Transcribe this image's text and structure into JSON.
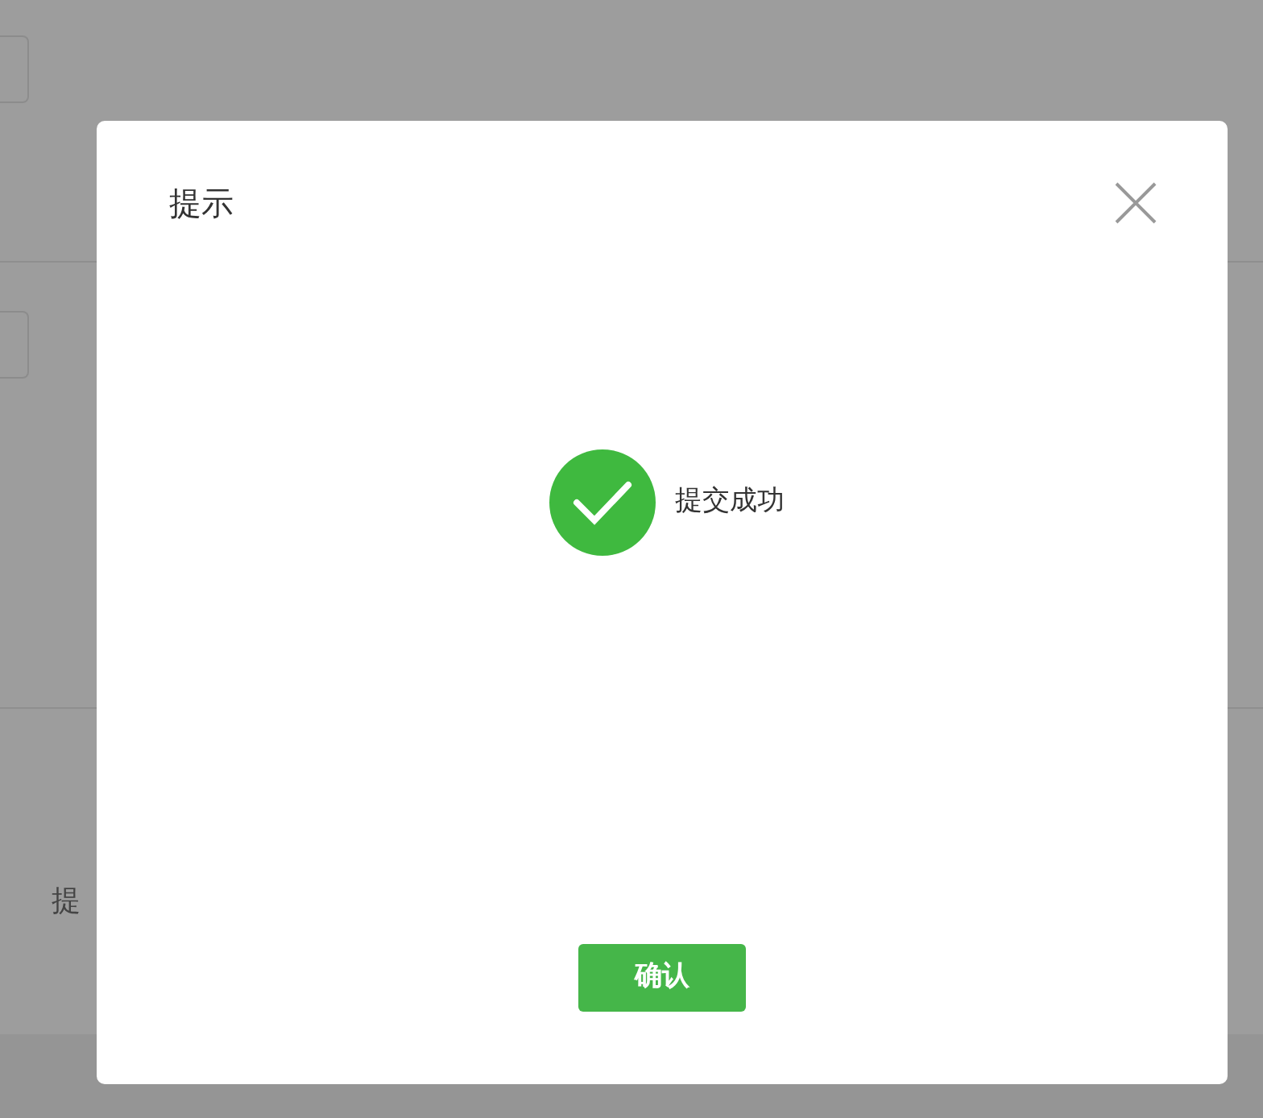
{
  "background_page": {
    "submit_label": "提"
  },
  "dialog": {
    "title": "提示",
    "message": "提交成功",
    "confirm_button": "确认"
  }
}
